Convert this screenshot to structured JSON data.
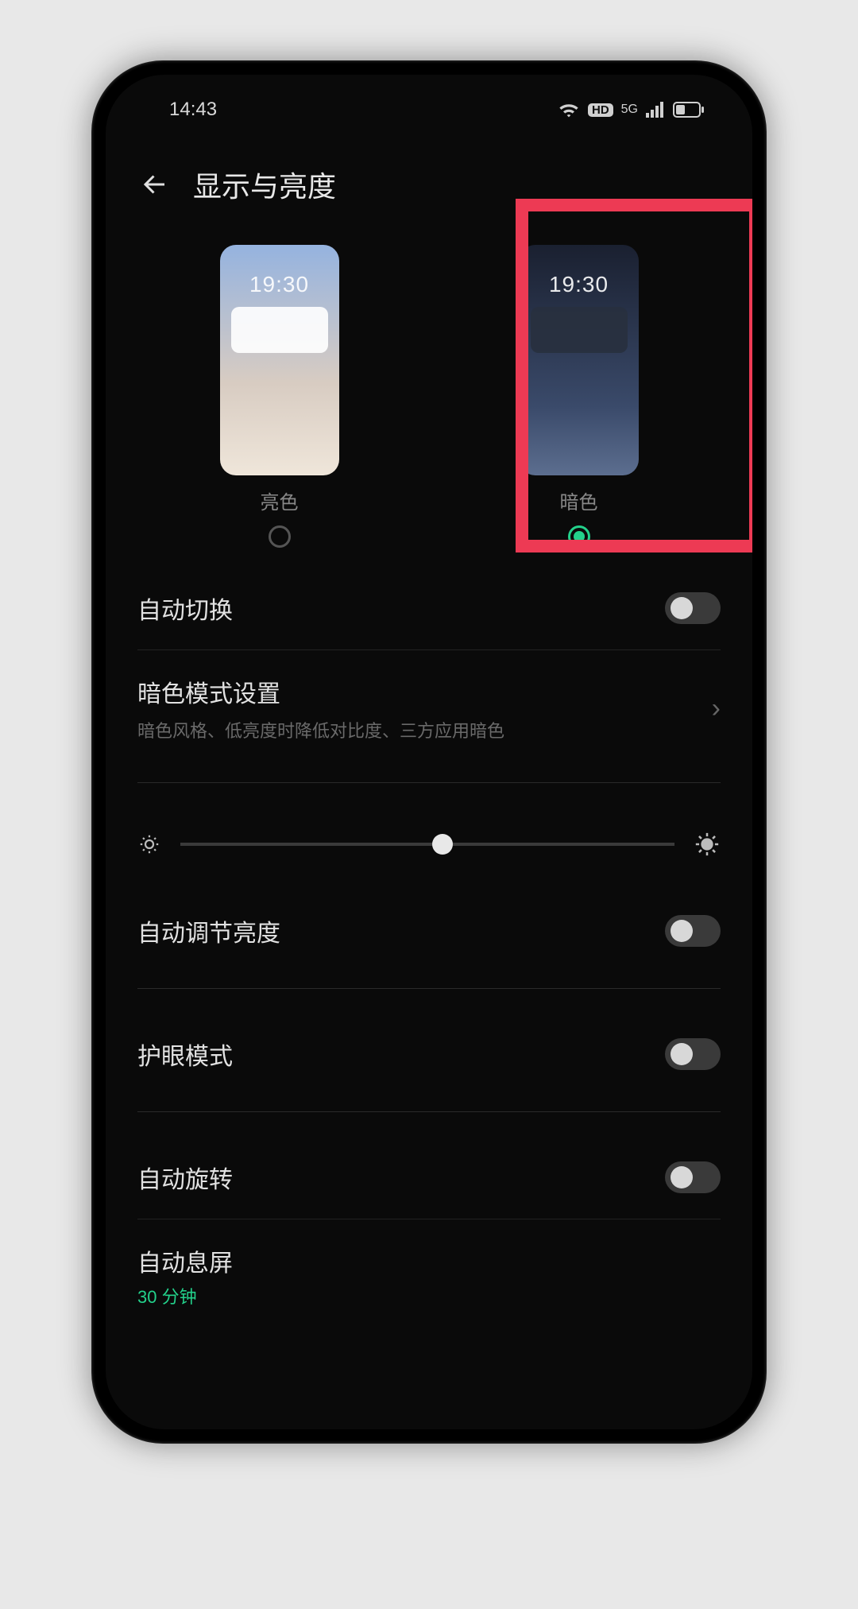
{
  "status": {
    "time": "14:43",
    "hd": "HD",
    "net": "5G"
  },
  "header": {
    "title": "显示与亮度"
  },
  "themes": {
    "preview_time": "19:30",
    "light_label": "亮色",
    "dark_label": "暗色",
    "selected": "dark"
  },
  "rows": {
    "auto_switch": "自动切换",
    "dark_settings_title": "暗色模式设置",
    "dark_settings_sub": "暗色风格、低亮度时降低对比度、三方应用暗色",
    "auto_brightness": "自动调节亮度",
    "eye_comfort": "护眼模式",
    "auto_rotate": "自动旋转",
    "auto_screen_off": "自动息屏",
    "auto_screen_off_value": "30 分钟"
  },
  "brightness": {
    "value_percent": 53
  }
}
